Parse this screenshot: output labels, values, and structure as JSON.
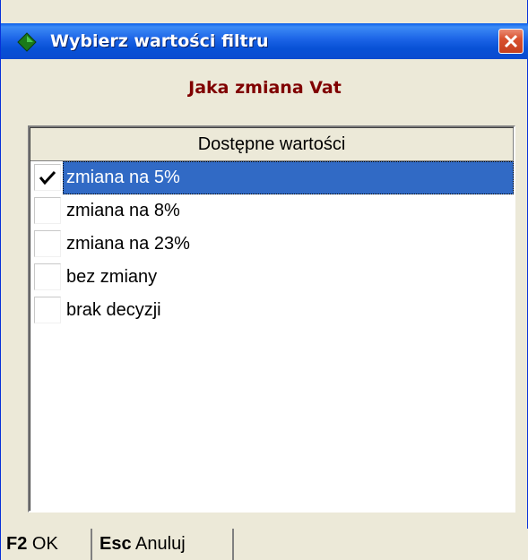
{
  "window": {
    "title": "Wybierz wartości filtru",
    "colors": {
      "titlebar": "#0a54e4",
      "close": "#d9512f",
      "subtitle": "#800000",
      "selection": "#316ac5"
    }
  },
  "dialog": {
    "subtitle": "Jaka zmiana Vat"
  },
  "grid": {
    "header": "Dostępne wartości",
    "rows": [
      {
        "label": "zmiana na 5%",
        "checked": true,
        "selected": true
      },
      {
        "label": "zmiana na 8%",
        "checked": false,
        "selected": false
      },
      {
        "label": "zmiana na 23%",
        "checked": false,
        "selected": false
      },
      {
        "label": "bez zmiany",
        "checked": false,
        "selected": false
      },
      {
        "label": "brak decyzji",
        "checked": false,
        "selected": false
      }
    ]
  },
  "statusbar": {
    "ok": {
      "key": "F2",
      "label": "OK"
    },
    "cancel": {
      "key": "Esc",
      "label": "Anuluj"
    }
  }
}
